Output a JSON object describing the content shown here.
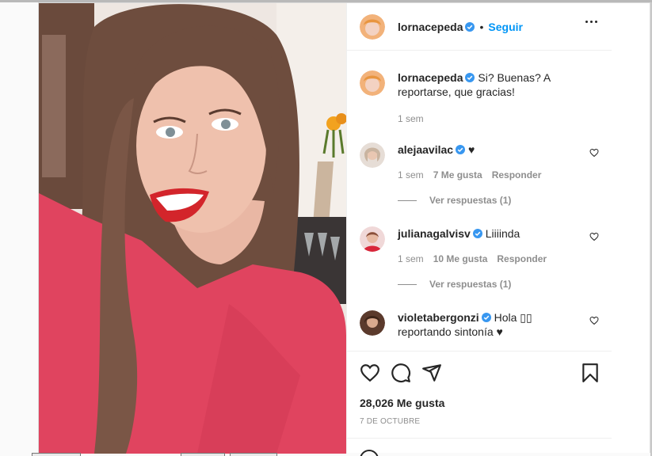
{
  "post": {
    "owner": {
      "username": "lornacepeda",
      "follow_label": "Seguir",
      "separator": "•"
    },
    "caption": {
      "username": "lornacepeda",
      "text": "Si? Buenas? A reportarse, que gracias!",
      "time": "1 sem"
    },
    "comments": [
      {
        "username": "alejaavilac",
        "text": "♥",
        "time": "1 sem",
        "likes": "7 Me gusta",
        "reply_label": "Responder",
        "view_replies": "Ver respuestas (1)"
      },
      {
        "username": "julianagalvisv",
        "text": "Liiiinda",
        "time": "1 sem",
        "likes": "10 Me gusta",
        "reply_label": "Responder",
        "view_replies": "Ver respuestas (1)"
      },
      {
        "username": "violetabergonzi",
        "text": "Hola ▯▯ reportando sintonía ♥"
      }
    ],
    "likes_count": "28,026 Me gusta",
    "date": "7 DE OCTUBRE",
    "icons": {
      "like": "heart-icon",
      "comment": "comment-icon",
      "share": "share-icon",
      "save": "bookmark-icon",
      "more": "more-options-icon",
      "verified": "verified-badge-icon"
    },
    "colors": {
      "accent": "#0095f6",
      "text": "#262626",
      "muted": "#8e8e8e",
      "verified": "#3897f0"
    }
  }
}
